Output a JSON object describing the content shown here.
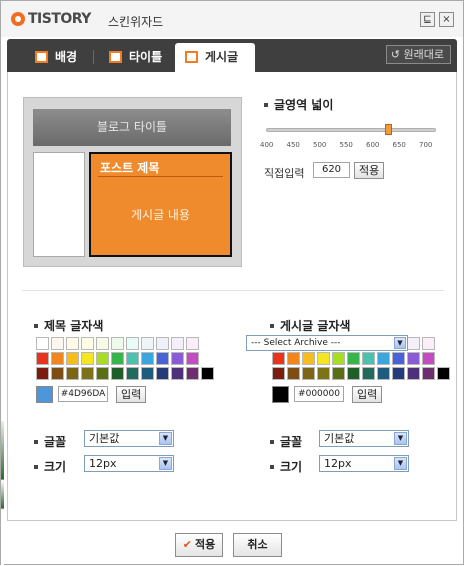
{
  "window": {
    "logo_text": "TISTORY",
    "title": "스킨위자드",
    "pin_symbol": "⊑",
    "close_symbol": "×"
  },
  "tabs": [
    {
      "label": "배경",
      "icon": "background-icon",
      "active": false
    },
    {
      "label": "타이틀",
      "icon": "title-icon",
      "active": false
    },
    {
      "label": "게시글",
      "icon": "post-icon",
      "active": true
    }
  ],
  "restore_label": "원래대로",
  "preview": {
    "blog_title": "블로그 타이틀",
    "post_title": "포스트 제목",
    "post_body": "게시글 내용",
    "accent_color": "#ef8b2c"
  },
  "width_section": {
    "title": "글영역 넓이",
    "ticks": [
      "400",
      "450",
      "500",
      "550",
      "600",
      "650",
      "700"
    ],
    "slider_value": 620,
    "slider_min": 400,
    "slider_max": 700,
    "direct_label": "직접입력",
    "direct_value": "620",
    "apply_label": "적용"
  },
  "title_color": {
    "title": "제목 글자색",
    "hex": "#4D96DA",
    "preview_color": "#4d96da",
    "input_label": "입력"
  },
  "post_color": {
    "title": "게시글 글자색",
    "hex": "#000000",
    "preview_color": "#000000",
    "input_label": "입력"
  },
  "archive_select": "--- Select Archive ---",
  "palette": [
    [
      "#ffffff",
      "#fff7ef",
      "#fffbe6",
      "#fffde3",
      "#f5fbe6",
      "#eefbea",
      "#e8fbf6",
      "#edf5fb",
      "#eef0fb",
      "#f5eefb",
      "#fbeefa"
    ],
    [
      "#e8341c",
      "#f2861e",
      "#f6bd1d",
      "#f5e625",
      "#a9dd22",
      "#37b44a",
      "#4cc1ae",
      "#3aa6dd",
      "#4a62d8",
      "#8b5bd6",
      "#c34cc0"
    ],
    [
      "#7a1c10",
      "#7c4e16",
      "#7d6515",
      "#7c7217",
      "#5a6f15",
      "#1f5e28",
      "#226a5e",
      "#1f5b7c",
      "#253a7a",
      "#4c307a",
      "#6c2e6c",
      "#000000"
    ]
  ],
  "title_font": {
    "label": "글꼴",
    "value": "기본값"
  },
  "title_size": {
    "label": "크기",
    "value": "12px"
  },
  "post_font": {
    "label": "글꼴",
    "value": "기본값"
  },
  "post_size": {
    "label": "크기",
    "value": "12px"
  },
  "footer": {
    "apply_label": "적용",
    "cancel_label": "취소"
  }
}
